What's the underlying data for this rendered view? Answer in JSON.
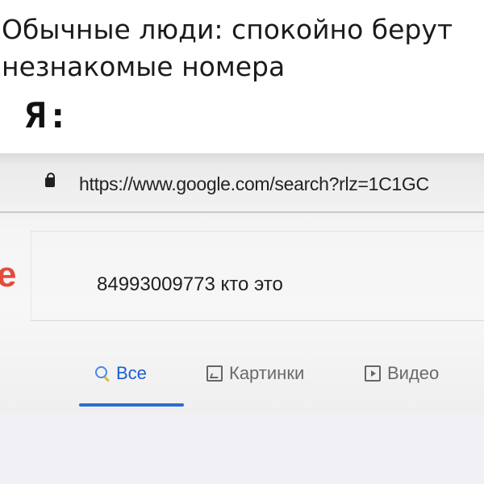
{
  "meme": {
    "caption_line1": "Обычные люди: спокойно берут",
    "caption_line2": "незнакомые номера",
    "me_label": "Я:"
  },
  "browser": {
    "url": "https://www.google.com/search?rlz=1C1GC",
    "logo_fragment": "e",
    "search_query": "84993009773 кто это",
    "tabs": [
      {
        "label": "Все",
        "icon": "search-icon",
        "active": true
      },
      {
        "label": "Картинки",
        "icon": "image-icon",
        "active": false
      },
      {
        "label": "Видео",
        "icon": "video-icon",
        "active": false
      }
    ],
    "active_tab_color": "#2f6bd6"
  }
}
